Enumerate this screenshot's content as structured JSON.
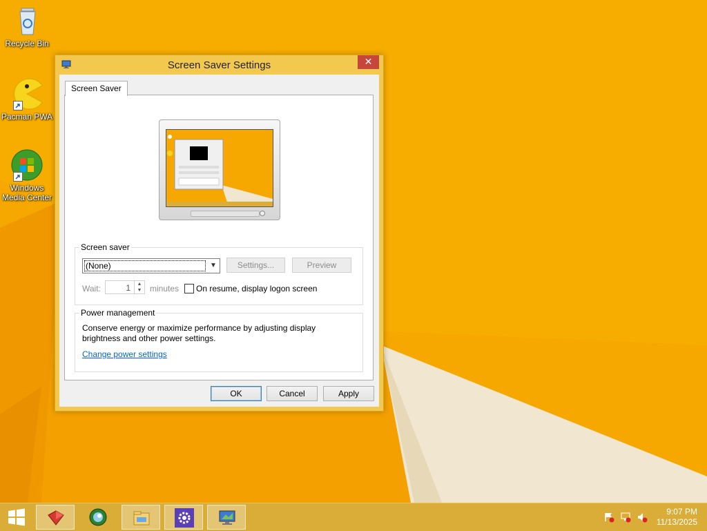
{
  "desktop": {
    "icons": [
      {
        "label": "Recycle Bin",
        "icon": "recycle-bin-icon"
      },
      {
        "label": "Pacman PWA",
        "icon": "pacman-icon"
      },
      {
        "label": "Windows Media Center",
        "icon": "windows-media-center-icon"
      }
    ]
  },
  "dialog": {
    "title": "Screen Saver Settings",
    "close_label": "✕",
    "tab_label": "Screen Saver",
    "screen_saver_group": {
      "title": "Screen saver",
      "selected": "(None)",
      "settings_label": "Settings...",
      "preview_label": "Preview",
      "wait_label": "Wait:",
      "wait_value": "1",
      "minutes_label": "minutes",
      "resume_label": "On resume, display logon screen"
    },
    "power_group": {
      "title": "Power management",
      "description_line1": "Conserve energy or maximize performance by adjusting display",
      "description_line2": "brightness and other power settings.",
      "link": "Change power settings"
    },
    "buttons": {
      "ok": "OK",
      "cancel": "Cancel",
      "apply": "Apply"
    }
  },
  "taskbar": {
    "items": [
      "start-icon",
      "toolbox-icon",
      "media-globe-icon",
      "file-explorer-icon",
      "settings-gear-icon",
      "screen-saver-icon"
    ],
    "tray_icons": [
      "action-center-icon",
      "network-icon",
      "volume-muted-icon"
    ],
    "clock": {
      "time": "9:07 PM",
      "date": "11/13/2025"
    }
  },
  "colors": {
    "desktop": "#f5a800",
    "dialog_frame": "#f2c94e",
    "close_button": "#c7463c",
    "taskbar": "#d9ad38",
    "link": "#0066cc"
  }
}
